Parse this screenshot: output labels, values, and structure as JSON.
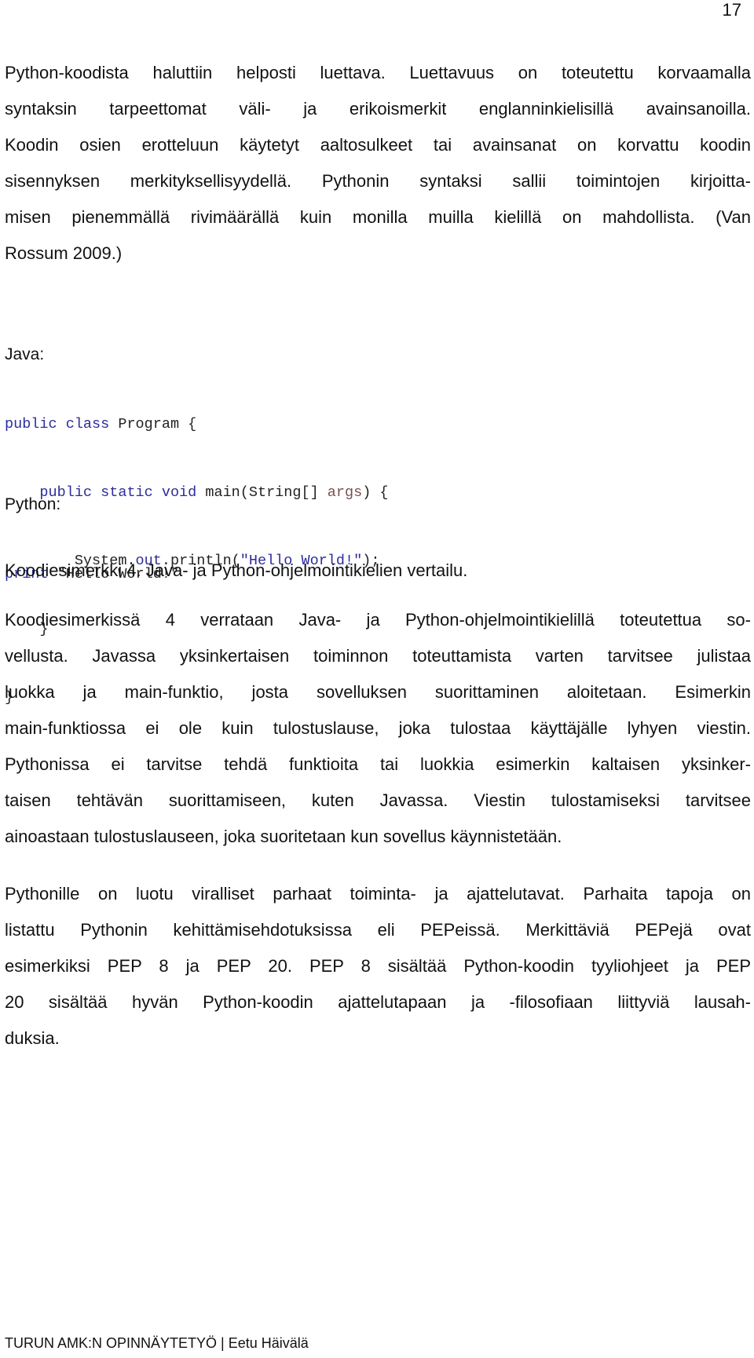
{
  "page": {
    "number": "17",
    "footer": "TURUN AMK:N OPINNÄYTETYÖ | Eetu Häivälä"
  },
  "paragraph1": {
    "lines": [
      "Python-koodista haluttiin helposti luettava. Luettavuus on toteutettu korvaamalla",
      "syntaksin tarpeettomat väli- ja erikoismerkit englanninkielisillä avainsanoilla.",
      "Koodin osien erotteluun käytetyt aaltosulkeet tai avainsanat on korvattu koodin",
      "sisennyksen merkityksellisyydellä. Pythonin syntaksi sallii toimintojen kirjoitta-",
      "misen pienemmällä rivimäärällä kuin monilla muilla kielillä on mahdollista. (Van",
      "Rossum 2009.)"
    ]
  },
  "code_example": {
    "java_label": "Java:",
    "java": {
      "line1": {
        "kw": "public class",
        "rest": " Program {"
      },
      "line2": {
        "indent": "    ",
        "kw": "public static void",
        "mid": " main(String[] ",
        "param": "args",
        "rest": ") {"
      },
      "line3": {
        "indent": "        ",
        "pre": "System.",
        "field": "out",
        "mid": ".println(",
        "str": "\"Hello World!\"",
        "rest": ");"
      },
      "line4": {
        "indent": "    ",
        "rest": "}"
      },
      "line5": {
        "rest": "}"
      }
    },
    "python_label": "Python:",
    "python": {
      "kw": "print",
      "rest": " \"Hello World!\""
    },
    "caption": "Koodiesimerkki 4. Java- ja Python-ohjelmointikielien vertailu."
  },
  "paragraph2": {
    "lines": [
      "Koodiesimerkissä 4 verrataan Java- ja Python-ohjelmointikielillä toteutettua so-",
      "vellusta. Javassa yksinkertaisen toiminnon toteuttamista varten tarvitsee julistaa",
      "luokka ja main-funktio, josta sovelluksen suorittaminen aloitetaan. Esimerkin",
      "main-funktiossa ei ole kuin tulostuslause, joka tulostaa käyttäjälle lyhyen viestin.",
      "Pythonissa ei tarvitse tehdä funktioita tai luokkia esimerkin kaltaisen yksinker-",
      "taisen tehtävän suorittamiseen, kuten Javassa. Viestin tulostamiseksi tarvitsee",
      "ainoastaan tulostuslauseen, joka suoritetaan kun sovellus käynnistetään."
    ]
  },
  "paragraph3": {
    "lines": [
      "Pythonille on luotu viralliset parhaat toiminta- ja ajattelutavat. Parhaita tapoja on",
      "listattu Pythonin kehittämisehdotuksissa eli PEPeissä.  Merkittäviä PEPejä ovat",
      "esimerkiksi PEP 8 ja PEP 20. PEP 8 sisältää Python-koodin tyyliohjeet ja PEP",
      "20 sisältää hyvän Python-koodin ajattelutapaan ja -filosofiaan liittyviä lausah-",
      "duksia."
    ]
  },
  "colors": {
    "text": "#111111",
    "code_keyword": "#2c2c9c",
    "code_string": "#2c2c9c",
    "code_parameter": "#7a5050"
  }
}
